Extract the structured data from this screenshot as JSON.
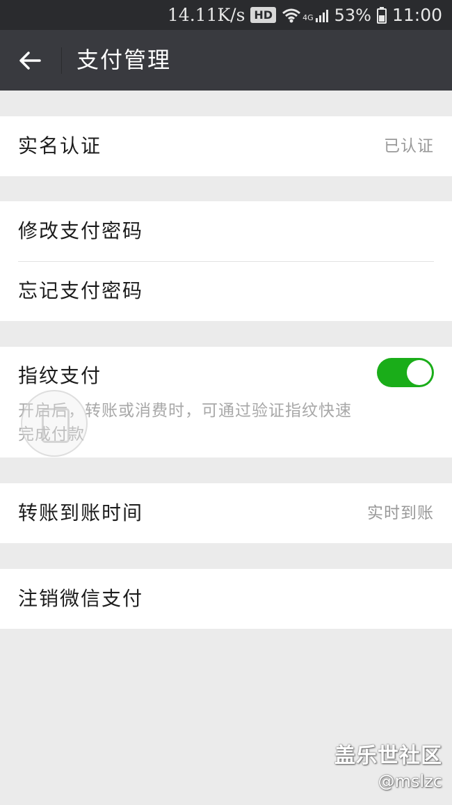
{
  "status_bar": {
    "speed": "14.11K/s",
    "hd_badge": "HD",
    "network_label": "4G",
    "battery": "53%",
    "time": "11:00"
  },
  "header": {
    "title": "支付管理",
    "back_icon": "arrow-left-icon"
  },
  "rows": {
    "real_name": {
      "label": "实名认证",
      "value": "已认证"
    },
    "change_password": {
      "label": "修改支付密码"
    },
    "forgot_password": {
      "label": "忘记支付密码"
    },
    "fingerprint": {
      "label": "指纹支付",
      "enabled": true,
      "description": "开启后，转账或消费时，可通过验证指纹快速完成付款"
    },
    "transfer_time": {
      "label": "转账到账时间",
      "value": "实时到账"
    },
    "cancel_wechat_pay": {
      "label": "注销微信支付"
    }
  },
  "watermark": {
    "title": "盖乐世社区",
    "handle": "@mslzc"
  },
  "colors": {
    "status_bar_bg": "#2a2b2e",
    "header_bg": "#393a3f",
    "page_bg": "#ebebeb",
    "toggle_on": "#1aad19"
  }
}
